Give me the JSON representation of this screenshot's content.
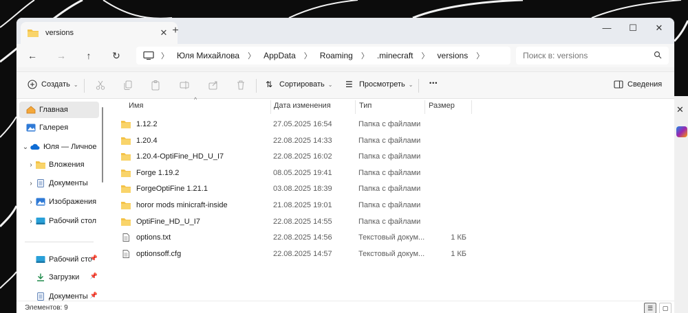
{
  "window": {
    "tab_title": "versions",
    "new_tab": "+",
    "tab_close": "✕",
    "minimize": "—",
    "maximize": "☐",
    "close": "✕"
  },
  "nav": {
    "back": "←",
    "forward": "→",
    "up": "↑",
    "refresh": "↻",
    "breadcrumbs": [
      "Юля Михайлова",
      "AppData",
      "Roaming",
      ".minecraft",
      "versions"
    ],
    "search_placeholder": "Поиск в: versions"
  },
  "commandbar": {
    "create": "Создать",
    "sort": "Сортировать",
    "view": "Просмотреть",
    "more": "•••",
    "details": "Сведения"
  },
  "sidebar": {
    "items": [
      {
        "label": "Главная",
        "icon": "home-icon"
      },
      {
        "label": "Галерея",
        "icon": "gallery-icon"
      },
      {
        "label": "Юля — Личное",
        "icon": "onedrive-icon"
      },
      {
        "label": "Вложения",
        "icon": "folder-icon"
      },
      {
        "label": "Документы",
        "icon": "documents-icon"
      },
      {
        "label": "Изображения",
        "icon": "pictures-icon"
      },
      {
        "label": "Рабочий стол",
        "icon": "desktop-icon"
      },
      {
        "label": "Рабочий сто",
        "icon": "desktop-icon"
      },
      {
        "label": "Загрузки",
        "icon": "downloads-icon"
      },
      {
        "label": "Документы",
        "icon": "documents-icon"
      }
    ]
  },
  "columns": {
    "name": "Имя",
    "date": "Дата изменения",
    "type": "Тип",
    "size": "Размер"
  },
  "files": [
    {
      "name": "1.12.2",
      "date": "27.05.2025 16:54",
      "type": "Папка с файлами",
      "size": "",
      "kind": "folder"
    },
    {
      "name": "1.20.4",
      "date": "22.08.2025 14:33",
      "type": "Папка с файлами",
      "size": "",
      "kind": "folder"
    },
    {
      "name": "1.20.4-OptiFine_HD_U_I7",
      "date": "22.08.2025 16:02",
      "type": "Папка с файлами",
      "size": "",
      "kind": "folder"
    },
    {
      "name": "Forge 1.19.2",
      "date": "08.05.2025 19:41",
      "type": "Папка с файлами",
      "size": "",
      "kind": "folder"
    },
    {
      "name": "ForgeOptiFine 1.21.1",
      "date": "03.08.2025 18:39",
      "type": "Папка с файлами",
      "size": "",
      "kind": "folder"
    },
    {
      "name": "horor mods minicraft-inside",
      "date": "21.08.2025 19:01",
      "type": "Папка с файлами",
      "size": "",
      "kind": "folder"
    },
    {
      "name": "OptiFine_HD_U_I7",
      "date": "22.08.2025 14:55",
      "type": "Папка с файлами",
      "size": "",
      "kind": "folder"
    },
    {
      "name": "options.txt",
      "date": "22.08.2025 14:56",
      "type": "Текстовый докум...",
      "size": "1 КБ",
      "kind": "file"
    },
    {
      "name": "optionsoff.cfg",
      "date": "22.08.2025 14:57",
      "type": "Текстовый докум...",
      "size": "1 КБ",
      "kind": "file"
    }
  ],
  "status": {
    "count": "Элементов: 9"
  },
  "colors": {
    "folder": "#f4c247",
    "accent": "#0067c0"
  }
}
